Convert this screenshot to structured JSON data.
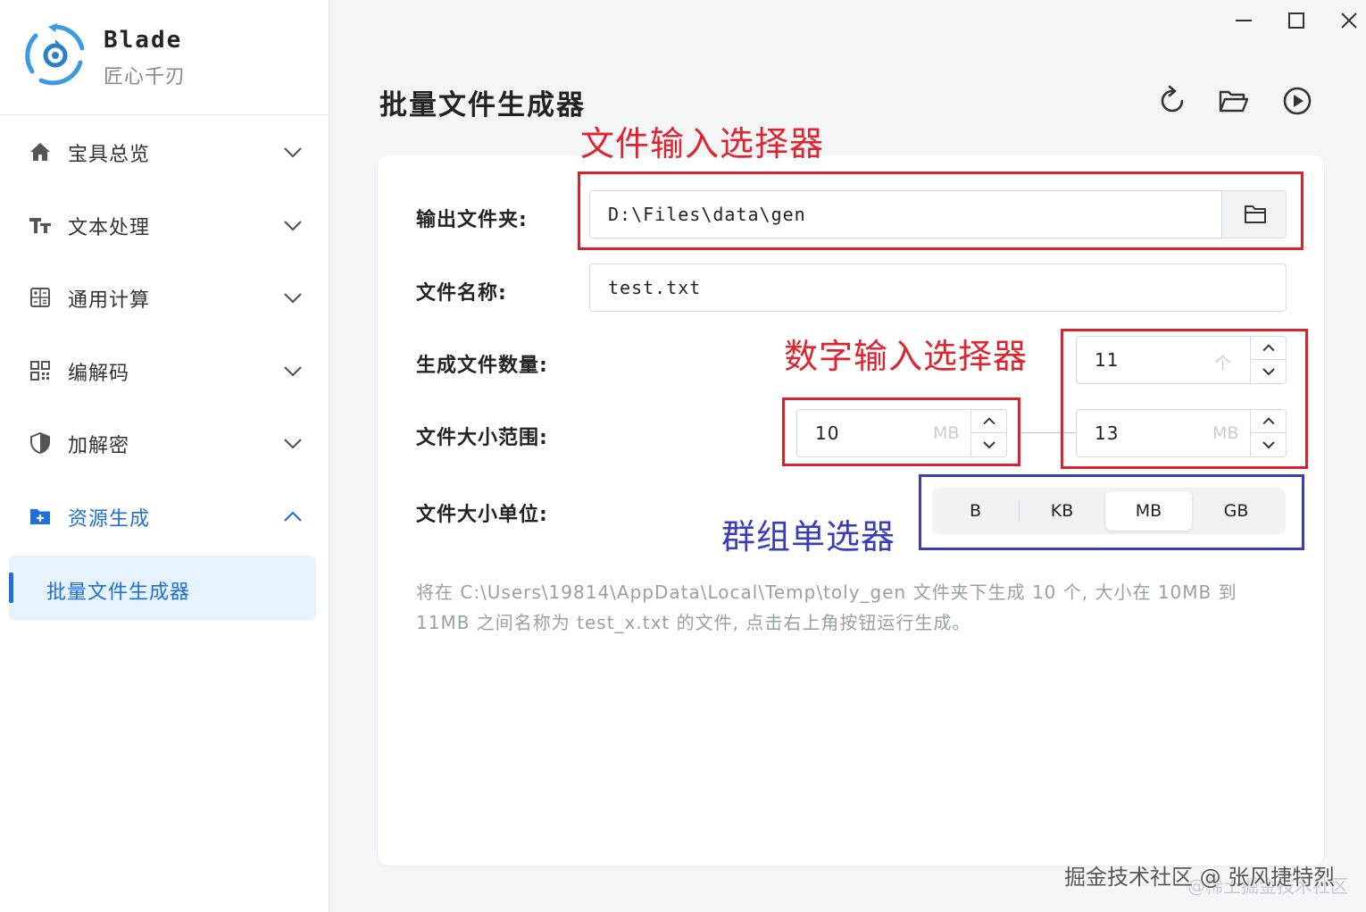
{
  "brand": {
    "name": "Blade",
    "subtitle": "匠心千刃"
  },
  "sidebar": {
    "items": [
      {
        "label": "宝具总览",
        "icon": "home-icon",
        "expanded": false
      },
      {
        "label": "文本处理",
        "icon": "text-format-icon",
        "expanded": false
      },
      {
        "label": "通用计算",
        "icon": "calculator-icon",
        "expanded": false
      },
      {
        "label": "编解码",
        "icon": "qr-code-icon",
        "expanded": false
      },
      {
        "label": "加解密",
        "icon": "shield-icon",
        "expanded": false
      },
      {
        "label": "资源生成",
        "icon": "folder-add-icon",
        "expanded": true
      }
    ],
    "active_sub": {
      "label": "批量文件生成器"
    }
  },
  "header": {
    "title": "批量文件生成器"
  },
  "toolbar": {
    "refresh_icon": "refresh-icon",
    "open_folder_icon": "open-folder-icon",
    "run_icon": "play-circle-icon"
  },
  "form": {
    "output_folder": {
      "label": "输出文件夹:",
      "value": "D:\\Files\\data\\gen"
    },
    "file_name": {
      "label": "文件名称:",
      "value": "test.txt"
    },
    "file_count": {
      "label": "生成文件数量:",
      "value": "11",
      "unit": "个"
    },
    "size_range": {
      "label": "文件大小范围:",
      "min": "10",
      "max": "13",
      "unit": "MB"
    },
    "size_unit": {
      "label": "文件大小单位:",
      "options": [
        "B",
        "KB",
        "MB",
        "GB"
      ],
      "selected": "MB"
    }
  },
  "hint": "将在 C:\\Users\\19814\\AppData\\Local\\Temp\\toly_gen 文件夹下生成 10 个, 大小在 10MB 到 11MB 之间名称为 test_x.txt 的文件, 点击右上角按钮运行生成。",
  "annotations": {
    "file_input": "文件输入选择器",
    "number_input": "数字输入选择器",
    "group_select": "群组单选器"
  },
  "watermark": {
    "main": "掘金技术社区 @ 张风捷特烈",
    "faint": "@稀土掘金技术社区"
  },
  "colors": {
    "accent": "#1e6fd9",
    "active_bg": "#e6f2fc",
    "annotation_red": "#d8222e",
    "annotation_blue": "#3a3db8"
  }
}
